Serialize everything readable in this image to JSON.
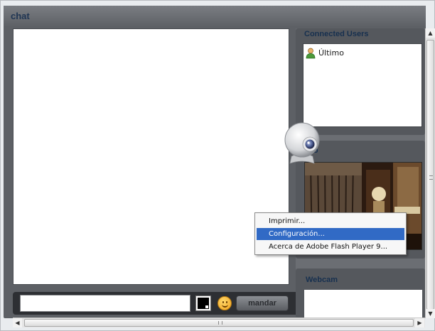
{
  "header": {
    "title": "chat"
  },
  "users_panel": {
    "title": "Connected Users",
    "users": [
      {
        "name": "Último"
      }
    ]
  },
  "camera_panel": {
    "title": "imo"
  },
  "webcam_panel": {
    "title": "Webcam"
  },
  "input_bar": {
    "message_value": "",
    "text_color": "#000000",
    "send_label": "mandar"
  },
  "context_menu": {
    "items": [
      {
        "label": "Imprimir..."
      },
      {
        "label": "Configuración...",
        "selected": true
      },
      {
        "label": "Acerca de Adobe Flash Player 9..."
      }
    ]
  },
  "colors": {
    "panel_bg": "#5d6065",
    "title_text": "#17304f",
    "menu_highlight": "#316ac5"
  }
}
